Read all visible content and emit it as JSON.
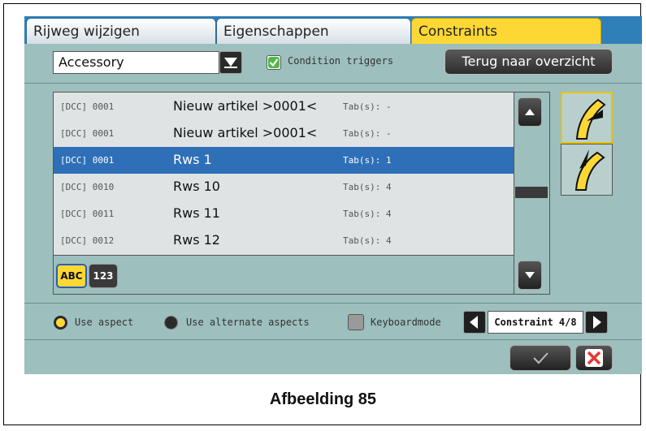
{
  "tabs": [
    {
      "label": "Rijweg wijzigen",
      "active": false
    },
    {
      "label": "Eigenschappen",
      "active": false
    },
    {
      "label": "Constraints",
      "active": true
    }
  ],
  "toolbar": {
    "dropdown_value": "Accessory",
    "condition_triggers_label": "Condition triggers",
    "condition_triggers_checked": true,
    "back_button_label": "Terug naar overzicht"
  },
  "list": {
    "rows": [
      {
        "address": "[DCC] 0001",
        "name": "Nieuw artikel >0001<",
        "tabs": "Tab(s): -",
        "selected": false
      },
      {
        "address": "[DCC] 0001",
        "name": "Nieuw artikel >0001<",
        "tabs": "Tab(s): -",
        "selected": false
      },
      {
        "address": "[DCC] 0001",
        "name": "Rws 1",
        "tabs": "Tab(s): 1",
        "selected": true
      },
      {
        "address": "[DCC] 0010",
        "name": "Rws 10",
        "tabs": "Tab(s): 4",
        "selected": false
      },
      {
        "address": "[DCC] 0011",
        "name": "Rws 11",
        "tabs": "Tab(s): 4",
        "selected": false
      },
      {
        "address": "[DCC] 0012",
        "name": "Rws 12",
        "tabs": "Tab(s): 4",
        "selected": false
      }
    ],
    "sort_abc_label": "ABC",
    "sort_num_label": "123"
  },
  "aspects": {
    "use_aspect_label": "Use aspect",
    "use_alternate_label": "Use alternate aspects",
    "keyboardmode_label": "Keyboardmode",
    "constraint_label": "Constraint 4/8"
  },
  "caption": "Afbeelding 85",
  "colors": {
    "accent": "#fdd835",
    "selected_row": "#2e6fb8",
    "panel": "#9dbfbd",
    "tabbar": "#2f7fb9"
  }
}
